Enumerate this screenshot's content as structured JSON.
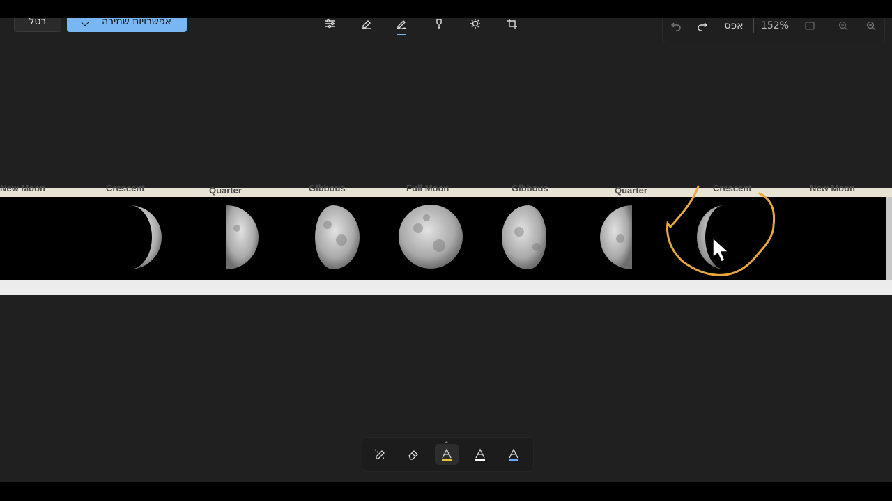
{
  "toolbar": {
    "cancel_label": "בטל",
    "save_label": "אפשרויות שמירה",
    "reset_label": "אפס",
    "zoom_level": "152%",
    "tools": [
      {
        "name": "adjust-icon"
      },
      {
        "name": "markup-eraser-icon"
      },
      {
        "name": "markup-pen-icon",
        "active": true
      },
      {
        "name": "filter-icon"
      },
      {
        "name": "brightness-icon"
      },
      {
        "name": "crop-icon"
      }
    ]
  },
  "image": {
    "labels": [
      "New Moon",
      "Crescent",
      "Quarter",
      "Gibbous",
      "Full Moon",
      "Gibbous",
      "Quarter",
      "Crescent",
      "New Moon"
    ],
    "annotation_color": "#e8a83a"
  },
  "pen_tray": {
    "tools": [
      {
        "name": "erase-all-icon"
      },
      {
        "name": "eraser-icon"
      },
      {
        "name": "highlighter-yellow-icon",
        "color": "#e8c33a",
        "active": true
      },
      {
        "name": "pen-white-icon",
        "color": "#ffffff"
      },
      {
        "name": "pen-blue-icon",
        "color": "#6aa9ff"
      }
    ]
  },
  "colors": {
    "accent": "#78b7f3",
    "background": "#202020"
  }
}
